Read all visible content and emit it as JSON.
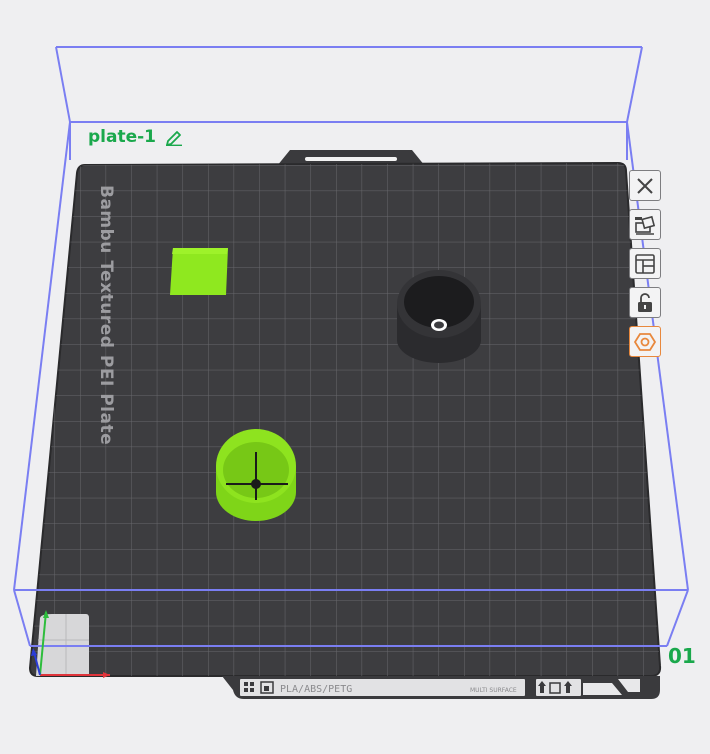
{
  "plate": {
    "name": "plate-1",
    "number": "01",
    "plate_type_label": "Bambu Textured PEI Plate",
    "footer_materials": "PLA/ABS/PETG",
    "footer_small_text": "MULTI SURFACE"
  },
  "toolbar": {
    "buttons": [
      {
        "name": "close-plate-button",
        "icon": "close-icon"
      },
      {
        "name": "auto-arrange-button",
        "icon": "arrange-icon"
      },
      {
        "name": "plate-settings-button",
        "icon": "layout-icon"
      },
      {
        "name": "lock-plate-button",
        "icon": "lock-icon"
      },
      {
        "name": "plate-type-button",
        "icon": "hex-nut-icon"
      }
    ]
  },
  "colors": {
    "bed": "#3d3d40",
    "grid": "#67676b",
    "bounding_box": "#7a7ef2",
    "plate_label": "#1aa84c",
    "object_green": "#8be21e",
    "object_dark": "#2c2c2f"
  },
  "objects": [
    {
      "name": "green-square"
    },
    {
      "name": "black-cylinder"
    },
    {
      "name": "green-cylinder"
    }
  ]
}
